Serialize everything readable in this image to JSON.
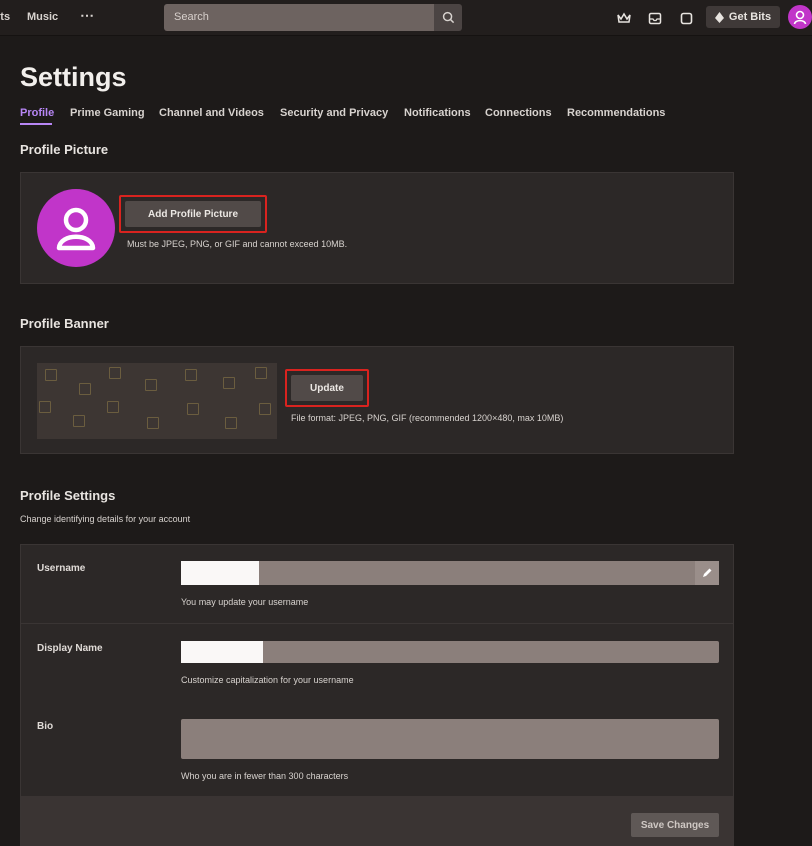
{
  "topbar": {
    "nav": [
      "rts",
      "Music",
      "⋯"
    ],
    "search_placeholder": "Search",
    "get_bits_label": "Get Bits"
  },
  "page": {
    "title": "Settings",
    "tabs": [
      "Profile",
      "Prime Gaming",
      "Channel and Videos",
      "Security and Privacy",
      "Notifications",
      "Connections",
      "Recommendations"
    ]
  },
  "profile_picture": {
    "section_title": "Profile Picture",
    "button_label": "Add Profile Picture",
    "hint": "Must be JPEG, PNG, or GIF and cannot exceed 10MB."
  },
  "profile_banner": {
    "section_title": "Profile Banner",
    "button_label": "Update",
    "hint": "File format: JPEG, PNG, GIF (recommended 1200×480, max 10MB)"
  },
  "profile_settings": {
    "section_title": "Profile Settings",
    "subtitle": "Change identifying details for your account",
    "username": {
      "label": "Username",
      "hint": "You may update your username"
    },
    "display_name": {
      "label": "Display Name",
      "hint": "Customize capitalization for your username"
    },
    "bio": {
      "label": "Bio",
      "hint": "Who you are in fewer than 300 characters"
    },
    "save_label": "Save Changes"
  },
  "colors": {
    "accent": "#b786f5",
    "avatar": "#c135c9",
    "highlight": "#d9231f"
  }
}
